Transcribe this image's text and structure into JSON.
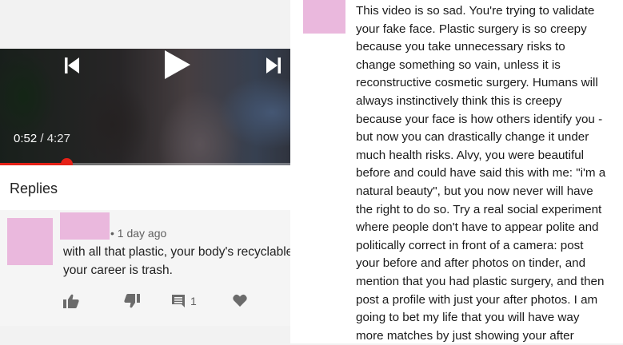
{
  "player": {
    "current_time": "0:52",
    "separator": "/",
    "duration": "4:27",
    "progress_fraction": 0.195
  },
  "replies": {
    "title": "Replies"
  },
  "comment": {
    "timestamp": "• 1 day ago",
    "text": "with all that plastic, your body's recyclable but your career is trash.",
    "reply_count": "1"
  },
  "long_comment": {
    "lines": [
      "This video is so sad. You're trying to validate",
      "your fake face. Plastic surgery is so creepy",
      "because you take unnecessary risks to",
      "change something so vain, unless it is",
      "reconstructive cosmetic surgery. Humans will",
      "always instinctively think this is creepy",
      "because your face is how others identify you -",
      "but now you can drastically change it under",
      "much health risks. Alvy, you were beautiful",
      "before and could have said this with me: \"i'm a",
      "natural beauty\", but you now never will have",
      "the right to do so. Try a real social experiment",
      "where people don't have to appear polite and",
      "politically correct in front of a camera: post",
      "your before and after photos on tinder, and",
      "mention that you had plastic surgery, and then",
      "post a profile with just your after photos. I am",
      "going to bet my life that you will have way",
      "more matches by just showing your after"
    ]
  },
  "colors": {
    "progress_red": "#e62117",
    "redacted_pink": "#eab8dd",
    "background": "#f2f2f2"
  },
  "icons": [
    "previous-icon",
    "play-icon",
    "next-icon",
    "fullscreen-icon",
    "close-icon",
    "thumbs-up-icon",
    "thumbs-down-icon",
    "reply-icon",
    "heart-icon",
    "more-vert-icon"
  ]
}
